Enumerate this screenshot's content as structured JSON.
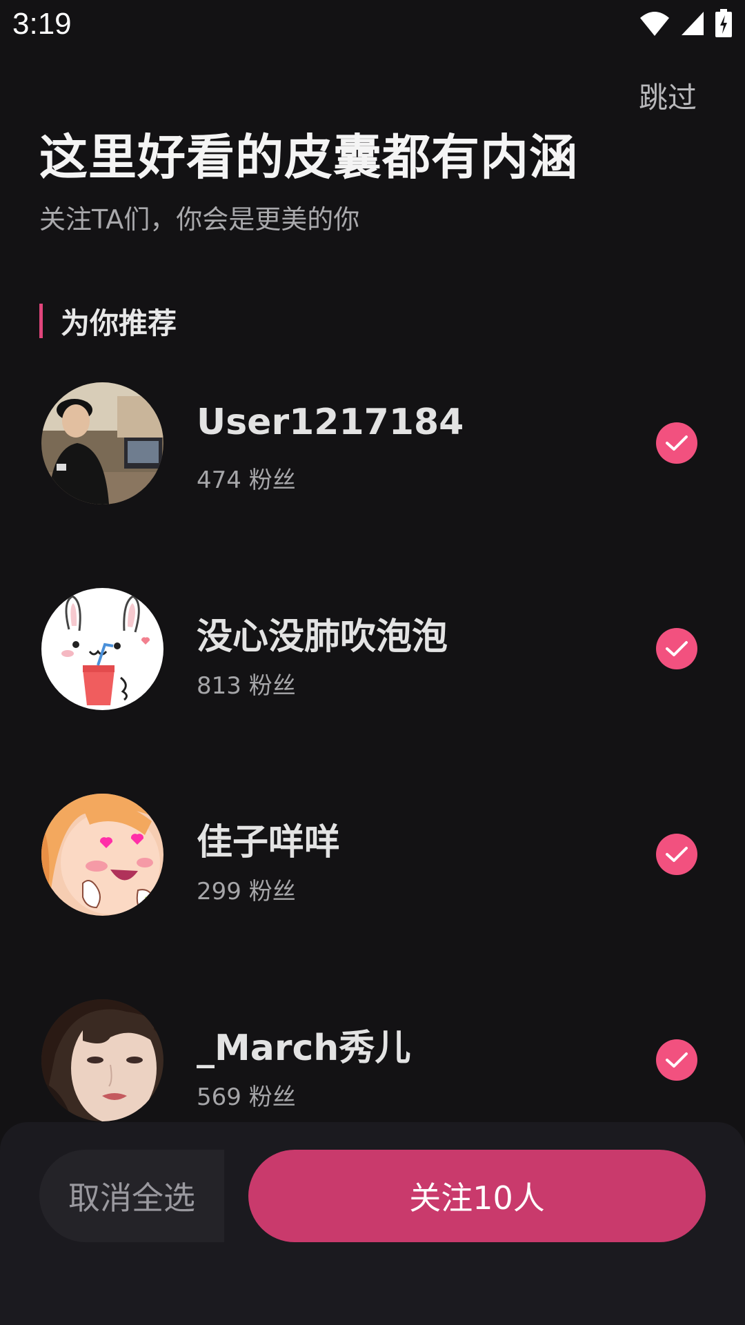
{
  "status_bar": {
    "time": "3:19",
    "icons": [
      "wifi-icon",
      "signal-icon",
      "battery-charging-icon"
    ]
  },
  "header": {
    "skip_label": "跳过",
    "title": "这里好看的皮囊都有内涵",
    "subtitle": "关注TA们，你会是更美的你"
  },
  "section": {
    "title": "为你推荐"
  },
  "users": [
    {
      "name": "User1217184",
      "fans": "474 粉丝",
      "selected": true,
      "avatar": "photo-man-avatar"
    },
    {
      "name": "没心没肺吹泡泡",
      "fans": "813 粉丝",
      "selected": true,
      "avatar": "bunny-cartoon-avatar"
    },
    {
      "name": "佳子咩咩",
      "fans": "299 粉丝",
      "selected": true,
      "avatar": "anime-girl-avatar"
    },
    {
      "name": "_March秀儿",
      "fans": "569 粉丝",
      "selected": true,
      "avatar": "photo-woman-avatar"
    }
  ],
  "footer": {
    "cancel_all_label": "取消全选",
    "follow_label": "关注10人"
  },
  "colors": {
    "background": "#131214",
    "accent": "#f2517f",
    "follow_button": "#c93a6c",
    "panel": "#1b1a1f"
  }
}
